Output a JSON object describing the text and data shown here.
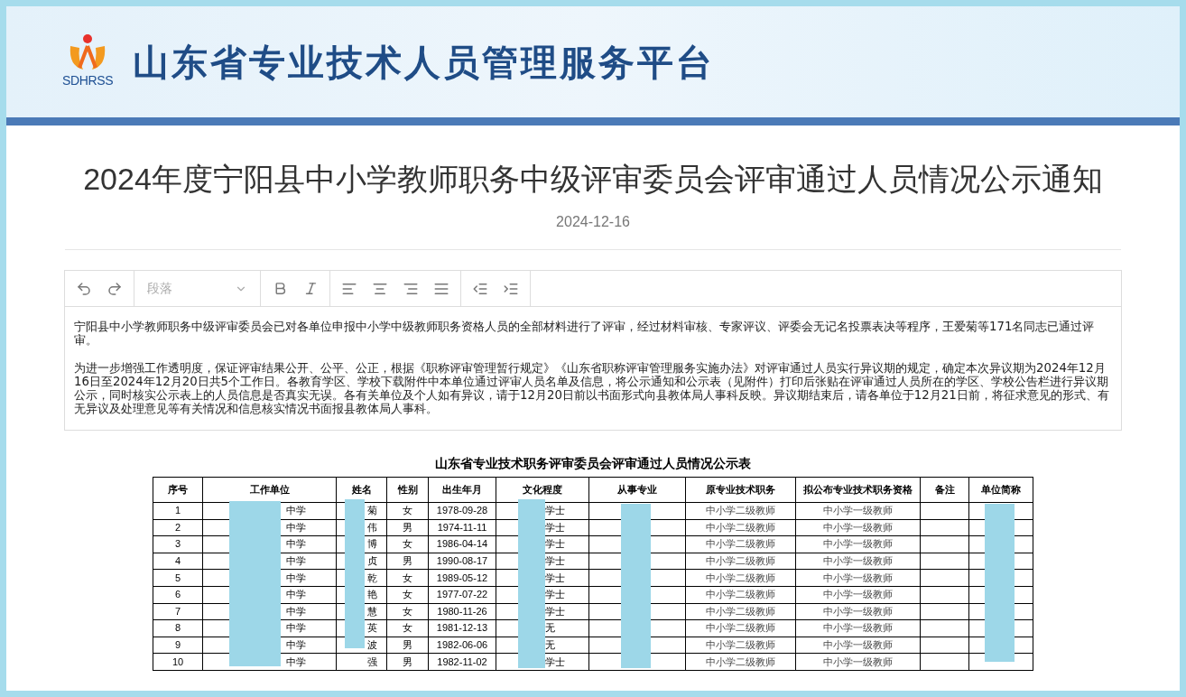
{
  "header": {
    "logo_text": "SDHRSS",
    "site_title": "山东省专业技术人员管理服务平台"
  },
  "article": {
    "title": "2024年度宁阳县中小学教师职务中级评审委员会评审通过人员情况公示通知",
    "date": "2024-12-16",
    "editor": {
      "block_format": "段落",
      "paragraphs": [
        "宁阳县中小学教师职务中级评审委员会已对各单位申报中小学中级教师职务资格人员的全部材料进行了评审，经过材料审核、专家评议、评委会无记名投票表决等程序，王爱菊等171名同志已通过评审。",
        "为进一步增强工作透明度，保证评审结果公开、公平、公正，根据《职称评审管理暂行规定》《山东省职称评审管理服务实施办法》对评审通过人员实行异议期的规定，确定本次异议期为2024年12月16日至2024年12月20日共5个工作日。各教育学区、学校下载附件中本单位通过评审人员名单及信息，将公示通知和公示表（见附件）打印后张贴在评审通过人员所在的学区、学校公告栏进行异议期公示，同时核实公示表上的人员信息是否真实无误。各有关单位及个人如有异议，请于12月20日前以书面形式向县教体局人事科反映。异议期结束后，请各单位于12月21日前，将征求意见的形式、有无异议及处理意见等有关情况和信息核实情况书面报县教体局人事科。"
      ]
    }
  },
  "table": {
    "caption": "山东省专业技术职务评审委员会评审通过人员情况公示表",
    "columns": [
      "序号",
      "工作单位",
      "姓名",
      "性别",
      "出生年月",
      "文化程度",
      "从事专业",
      "原专业技术职务",
      "拟公布专业技术职务资格",
      "备注",
      "单位简称"
    ],
    "rows": [
      {
        "no": "1",
        "unit": "中学",
        "name": "菊",
        "gender": "女",
        "birth": "1978-09-28",
        "education": "学士",
        "position_from": "中小学二级教师",
        "position_to": "中小学一级教师"
      },
      {
        "no": "2",
        "unit": "中学",
        "name": "伟",
        "gender": "男",
        "birth": "1974-11-11",
        "education": "学士",
        "position_from": "中小学二级教师",
        "position_to": "中小学一级教师"
      },
      {
        "no": "3",
        "unit": "中学",
        "name": "博",
        "gender": "女",
        "birth": "1986-04-14",
        "education": "学士",
        "position_from": "中小学二级教师",
        "position_to": "中小学一级教师"
      },
      {
        "no": "4",
        "unit": "中学",
        "name": "贞",
        "gender": "男",
        "birth": "1990-08-17",
        "education": "学士",
        "position_from": "中小学二级教师",
        "position_to": "中小学一级教师"
      },
      {
        "no": "5",
        "unit": "中学",
        "name": "乾",
        "gender": "女",
        "birth": "1989-05-12",
        "education": "学士",
        "position_from": "中小学二级教师",
        "position_to": "中小学一级教师"
      },
      {
        "no": "6",
        "unit": "中学",
        "name": "艳",
        "gender": "女",
        "birth": "1977-07-22",
        "education": "学士",
        "position_from": "中小学二级教师",
        "position_to": "中小学一级教师"
      },
      {
        "no": "7",
        "unit": "中学",
        "name": "慧",
        "gender": "女",
        "birth": "1980-11-26",
        "education": "学士",
        "position_from": "中小学二级教师",
        "position_to": "中小学一级教师"
      },
      {
        "no": "8",
        "unit": "中学",
        "name": "英",
        "gender": "女",
        "birth": "1981-12-13",
        "education": "无",
        "position_from": "中小学二级教师",
        "position_to": "中小学一级教师"
      },
      {
        "no": "9",
        "unit": "中学",
        "name": "波",
        "gender": "男",
        "birth": "1982-06-06",
        "education": "无",
        "position_from": "中小学二级教师",
        "position_to": "中小学一级教师"
      },
      {
        "no": "10",
        "unit": "中学",
        "name": "强",
        "gender": "男",
        "birth": "1982-11-02",
        "education": "学士",
        "position_from": "中小学二级教师",
        "position_to": "中小学一级教师"
      }
    ]
  }
}
